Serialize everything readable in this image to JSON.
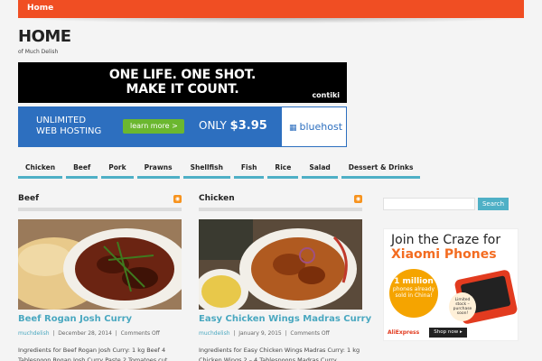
{
  "topnav": {
    "home": "Home"
  },
  "site": {
    "title": "HOME",
    "tagline": "of Much Delish"
  },
  "ads": {
    "contiki": {
      "line1": "ONE LIFE.  ONE SHOT.",
      "line2": "MAKE IT COUNT.",
      "brand": "contiki"
    },
    "bluehost": {
      "line1": "UNLIMITED",
      "line2": "WEB HOSTING",
      "button": "learn more  >",
      "only": "ONLY",
      "price": "$3.95",
      "brand": "bluehost"
    },
    "xiaomi": {
      "headline1": "Join the Craze for",
      "headline2": "Xiaomi Phones",
      "burst_big": "1 million",
      "burst_text": "phones already sold in China!",
      "tag": "Limited stock – purchase soon!",
      "store": "AliExpress",
      "shop": "Shop now ▸"
    }
  },
  "nav": [
    "Chicken",
    "Beef",
    "Pork",
    "Prawns",
    "Shellfish",
    "Fish",
    "Rice",
    "Salad",
    "Dessert & Drinks"
  ],
  "columns": [
    {
      "heading": "Beef",
      "post": {
        "title": "Beef Rogan Josh Curry",
        "author": "muchdelish",
        "date": "December 28, 2014",
        "comments": "Comments Off",
        "excerpt": "Ingredients for Beef Rogan Josh Curry: 1 kg Beef 4 Tablespoon Rogan Josh Curry Paste 2 Tomatoes cut"
      }
    },
    {
      "heading": "Chicken",
      "post": {
        "title": "Easy Chicken Wings Madras Curry",
        "author": "muchdelish",
        "date": "January 9, 2015",
        "comments": "Comments Off",
        "excerpt": "Ingredients for Easy Chicken Wings Madras Curry: 1 kg Chicken Wings 2 – 4 Tablespoons Madras Curry"
      }
    }
  ],
  "sidebar": {
    "search_button": "Search",
    "search_placeholder": ""
  },
  "colors": {
    "accent": "#f04e23",
    "link": "#4aa8c0",
    "nav_underline": "#4fb0c6"
  }
}
